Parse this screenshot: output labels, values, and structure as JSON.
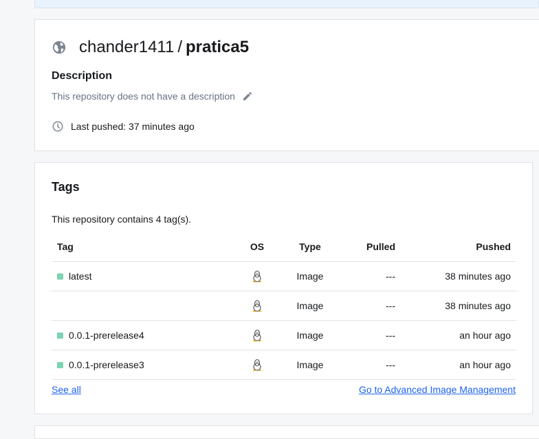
{
  "repo": {
    "namespace": "chander1411",
    "separator": "/",
    "name": "pratica5",
    "description_label": "Description",
    "description_text": "This repository does not have a description",
    "last_pushed": "Last pushed: 37 minutes ago"
  },
  "tags": {
    "title": "Tags",
    "count_text": "This repository contains 4 tag(s).",
    "columns": {
      "tag": "Tag",
      "os": "OS",
      "type": "Type",
      "pulled": "Pulled",
      "pushed": "Pushed"
    },
    "rows": [
      {
        "tag": "latest",
        "type": "Image",
        "pulled": "---",
        "pushed": "38 minutes ago"
      },
      {
        "tag": "",
        "type": "Image",
        "pulled": "---",
        "pushed": "38 minutes ago"
      },
      {
        "tag": "0.0.1-prerelease4",
        "type": "Image",
        "pulled": "---",
        "pushed": "an hour ago"
      },
      {
        "tag": "0.0.1-prerelease3",
        "type": "Image",
        "pulled": "---",
        "pushed": "an hour ago"
      }
    ],
    "see_all": "See all",
    "advanced_link": "Go to Advanced Image Management"
  },
  "colors": {
    "accent": "#1d63ed",
    "tag_dot": "#7dd3b2",
    "muted": "#677285"
  }
}
